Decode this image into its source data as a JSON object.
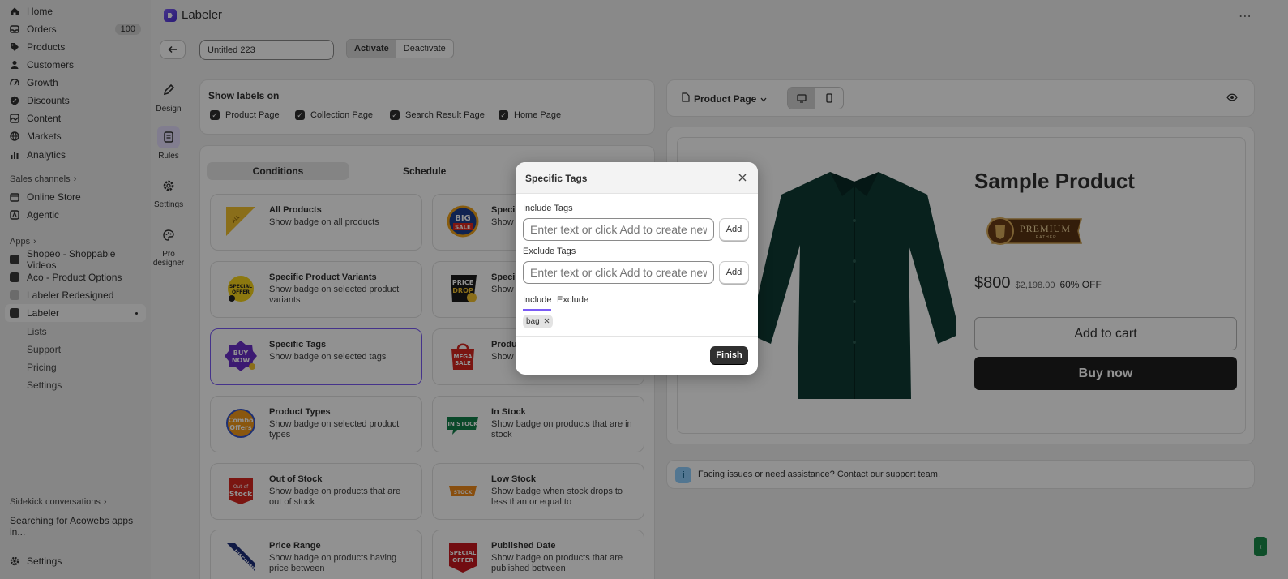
{
  "sidebar": {
    "items": [
      {
        "label": "Home",
        "icon": "home-icon"
      },
      {
        "label": "Orders",
        "icon": "orders-icon",
        "badge": "100"
      },
      {
        "label": "Products",
        "icon": "tag-icon"
      },
      {
        "label": "Customers",
        "icon": "person-icon"
      },
      {
        "label": "Growth",
        "icon": "growth-icon"
      },
      {
        "label": "Discounts",
        "icon": "discount-icon"
      },
      {
        "label": "Content",
        "icon": "content-icon"
      },
      {
        "label": "Markets",
        "icon": "globe-icon"
      },
      {
        "label": "Analytics",
        "icon": "chart-icon"
      }
    ],
    "sales_channels_label": "Sales channels",
    "channels": [
      {
        "label": "Online Store",
        "icon": "store-icon"
      },
      {
        "label": "Agentic",
        "icon": "agentic-icon"
      }
    ],
    "apps_label": "Apps",
    "apps": [
      {
        "label": "Shopeo - Shoppable Videos"
      },
      {
        "label": "Aco - Product Options"
      },
      {
        "label": "Labeler Redesigned"
      },
      {
        "label": "Labeler"
      }
    ],
    "sub_items": [
      "Lists",
      "Support",
      "Pricing",
      "Settings"
    ],
    "sidekick_label": "Sidekick conversations",
    "sidekick_item": "Searching for Acowebs apps in...",
    "settings_label": "Settings"
  },
  "topbar": {
    "app_name": "Labeler",
    "menu": "⋯"
  },
  "toolbar": {
    "title_value": "Untitled 223",
    "activate_label": "Activate",
    "deactivate_label": "Deactivate"
  },
  "rail": [
    {
      "label": "Design"
    },
    {
      "label": "Rules"
    },
    {
      "label": "Settings"
    },
    {
      "label": "Pro designer"
    }
  ],
  "show_labels": {
    "title": "Show labels on",
    "options": [
      "Product Page",
      "Collection Page",
      "Search Result Page",
      "Home Page"
    ]
  },
  "rules_tabs": {
    "conditions": "Conditions",
    "schedule": "Schedule"
  },
  "rules": [
    {
      "title": "All Products",
      "desc": "Show badge on all products",
      "badge": "ALL PRODUCTS"
    },
    {
      "title": "Speci",
      "desc": "Show",
      "badge": "BIG SALE"
    },
    {
      "title": "Specific Product Variants",
      "desc": "Show badge on selected product variants",
      "badge": "SPECIAL OFFER"
    },
    {
      "title": "Speci",
      "desc": "Show",
      "badge": "PRICE DROP"
    },
    {
      "title": "Specific Tags",
      "desc": "Show badge on selected tags",
      "badge": "BUY NOW"
    },
    {
      "title": "Produ",
      "desc": "Show vendo",
      "badge": "MEGA SALE"
    },
    {
      "title": "Product Types",
      "desc": "Show badge on selected product types",
      "badge": "Combo Offers"
    },
    {
      "title": "In Stock",
      "desc": "Show badge on products that are in stock",
      "badge": "IN STOCK"
    },
    {
      "title": "Out of Stock",
      "desc": "Show badge on products that are out of stock",
      "badge": "Out of Stock"
    },
    {
      "title": "Low Stock",
      "desc": "Show badge when stock drops to less than or equal to",
      "badge": "STOCK"
    },
    {
      "title": "Price Range",
      "desc": "Show badge on products having price between",
      "badge": "DISCOUNT"
    },
    {
      "title": "Published Date",
      "desc": "Show badge on products that are published between",
      "badge": "SPECIAL OFFER"
    }
  ],
  "preview": {
    "page_select": "Product Page",
    "product_title": "Sample Product",
    "premium_text": "PREMIUM",
    "premium_sub": "LEATHER",
    "price": "$800",
    "old_price": "$2,198.00",
    "discount": "60% OFF",
    "add_to_cart": "Add to cart",
    "buy_now": "Buy now"
  },
  "help": {
    "text": "Facing issues or need assistance? ",
    "link": "Contact our support team",
    "suffix": "."
  },
  "modal": {
    "title": "Specific Tags",
    "include_label": "Include Tags",
    "include_placeholder": "Enter text or click Add to create new",
    "exclude_label": "Exclude Tags",
    "exclude_placeholder": "Enter text or click Add to create new",
    "add_label": "Add",
    "tab_include": "Include",
    "tab_exclude": "Exclude",
    "chip": "bag",
    "finish_label": "Finish"
  },
  "colors": {
    "accent": "#7a5af5",
    "overlay": "rgba(0,0,0,0.43)",
    "dark_button": "#303030"
  }
}
